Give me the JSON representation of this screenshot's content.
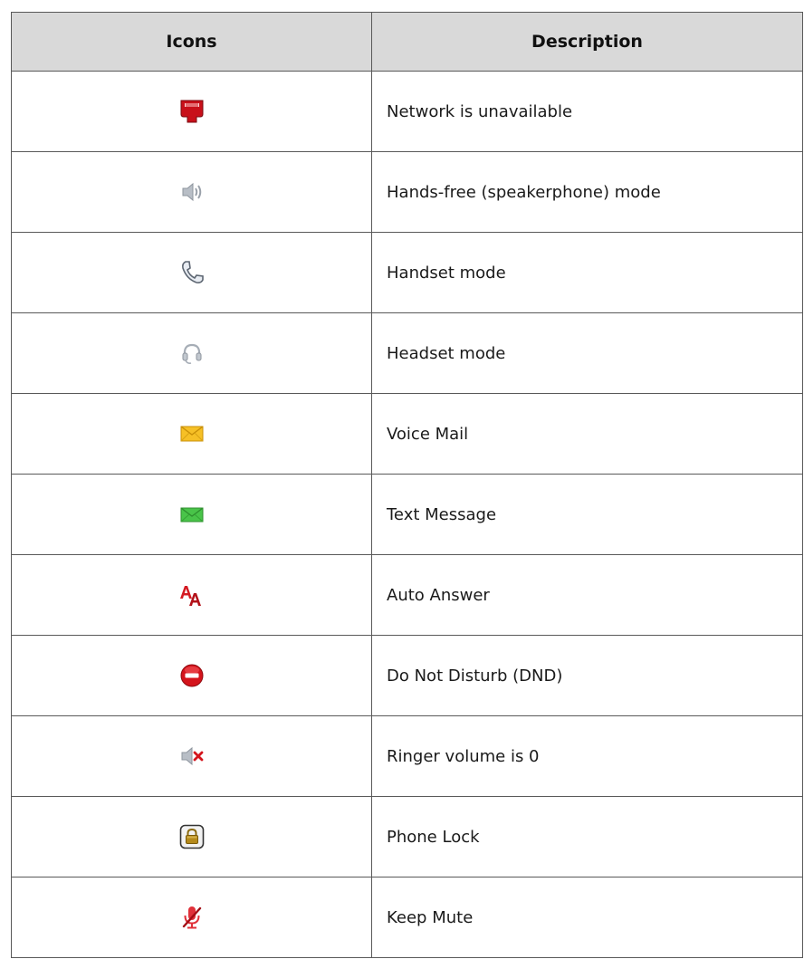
{
  "table": {
    "headers": [
      "Icons",
      "Description"
    ],
    "rows": [
      {
        "icon": "network-unavailable-icon",
        "description": "Network is unavailable"
      },
      {
        "icon": "speakerphone-icon",
        "description": "Hands-free (speakerphone) mode"
      },
      {
        "icon": "handset-icon",
        "description": "Handset mode"
      },
      {
        "icon": "headset-icon",
        "description": "Headset mode"
      },
      {
        "icon": "voice-mail-icon",
        "description": "Voice Mail"
      },
      {
        "icon": "text-message-icon",
        "description": "Text Message"
      },
      {
        "icon": "auto-answer-icon",
        "description": "Auto Answer"
      },
      {
        "icon": "do-not-disturb-icon",
        "description": "Do Not Disturb (DND)"
      },
      {
        "icon": "ringer-muted-icon",
        "description": "Ringer volume is 0"
      },
      {
        "icon": "phone-lock-icon",
        "description": "Phone Lock"
      },
      {
        "icon": "keep-mute-icon",
        "description": "Keep Mute"
      }
    ]
  },
  "colors": {
    "header_bg": "#d9d9d9",
    "border": "#595959",
    "network_red": "#c8101a",
    "mail_yellow": "#f6c026",
    "message_green": "#3fbf3f",
    "dnd_red": "#d4141c",
    "lock_gold": "#b58a1b"
  }
}
